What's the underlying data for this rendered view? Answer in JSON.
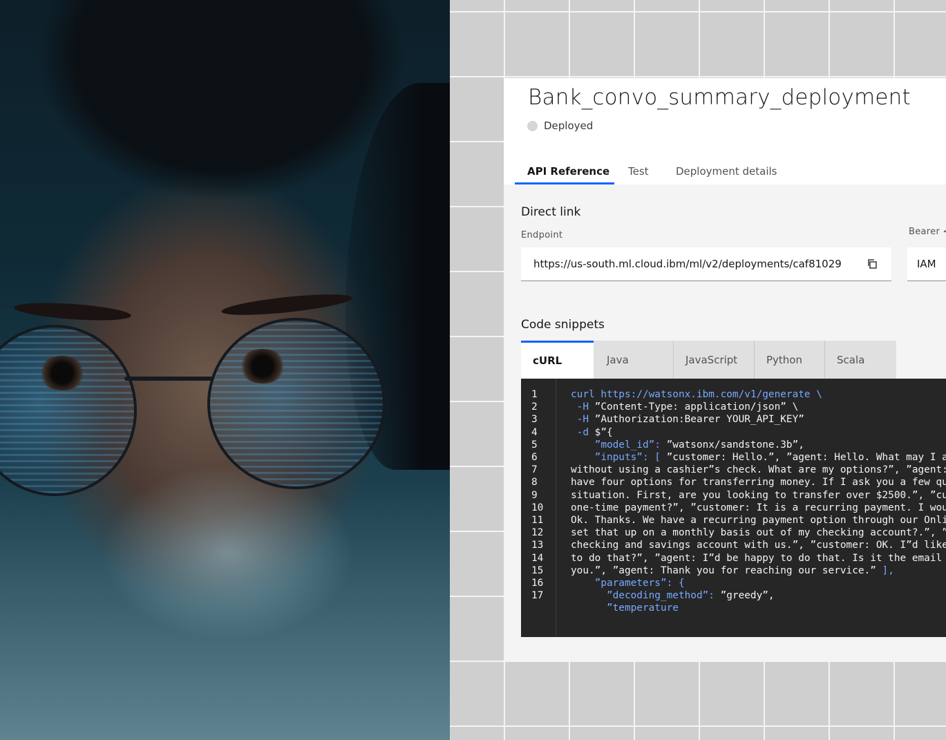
{
  "deployment": {
    "title": "Bank_convo_summary_deployment",
    "status": "Deployed"
  },
  "tabs": [
    {
      "label": "API Reference",
      "active": true
    },
    {
      "label": "Test",
      "active": false
    },
    {
      "label": "Deployment details",
      "active": false
    }
  ],
  "direct_link": {
    "heading": "Direct link",
    "endpoint_label": "Endpoint",
    "endpoint_value": "https://us-south.ml.cloud.ibm/ml/v2/deployments/caf81029",
    "bearer_label": "Bearer <",
    "bearer_value": "IAM"
  },
  "code_snippets": {
    "heading": "Code snippets",
    "languages": [
      {
        "label": "cURL",
        "active": true
      },
      {
        "label": "Java",
        "active": false
      },
      {
        "label": "JavaScript",
        "active": false
      },
      {
        "label": "Python",
        "active": false
      },
      {
        "label": "Scala",
        "active": false
      }
    ],
    "lines": [
      {
        "n": "1",
        "parts": [
          {
            "t": "curl https://watsonx.ibm.com/v1/generate \\",
            "c": "k"
          }
        ]
      },
      {
        "n": "2",
        "parts": [
          {
            "t": " -H ",
            "c": "k"
          },
          {
            "t": "”Content-Type: application/json” \\",
            "c": "s"
          }
        ]
      },
      {
        "n": "3",
        "parts": [
          {
            "t": " -H ",
            "c": "k"
          },
          {
            "t": "”Authorization:Bearer YOUR_API_KEY”",
            "c": "s"
          }
        ]
      },
      {
        "n": "4",
        "parts": [
          {
            "t": " -d ",
            "c": "k"
          },
          {
            "t": "$”{",
            "c": "s"
          }
        ]
      },
      {
        "n": "5",
        "parts": [
          {
            "t": "    ”model_id”: ",
            "c": "k"
          },
          {
            "t": "”watsonx/sandstone.3b”,",
            "c": "s"
          }
        ]
      },
      {
        "n": "6",
        "parts": [
          {
            "t": "    ”inputs”: [ ",
            "c": "k"
          },
          {
            "t": "”customer: Hello.”, ”agent: Hello. What may I as",
            "c": "s"
          }
        ]
      },
      {
        "n": "7",
        "parts": [
          {
            "t": "without using a cashier”s check. What are my options?”, ”agent: ",
            "c": "s"
          }
        ]
      },
      {
        "n": "8",
        "parts": [
          {
            "t": "have four options for transferring money. If I ask you a few que",
            "c": "s"
          }
        ]
      },
      {
        "n": "9",
        "parts": [
          {
            "t": "situation. First, are you looking to transfer over $2500.”, ”cus",
            "c": "s"
          }
        ]
      },
      {
        "n": "10",
        "parts": [
          {
            "t": "one-time payment?”, ”customer: It is a recurring payment. I woul",
            "c": "s"
          }
        ]
      },
      {
        "n": "11",
        "parts": [
          {
            "t": "Ok. Thanks. We have a recurring payment option through our Onlin",
            "c": "s"
          }
        ]
      },
      {
        "n": "12",
        "parts": [
          {
            "t": "set that up on a monthly basis out of my checking account?.”, ”a",
            "c": "s"
          }
        ]
      },
      {
        "n": "13",
        "parts": [
          {
            "t": "checking and savings account with us.”, ”customer: OK. I”d like ",
            "c": "s"
          }
        ]
      },
      {
        "n": "14",
        "parts": [
          {
            "t": "to do that?”, ”agent: I”d be happy to do that. Is it the email y",
            "c": "s"
          }
        ]
      },
      {
        "n": "15",
        "parts": [
          {
            "t": "you.”, ”agent: Thank you for reaching our service.” ",
            "c": "s"
          },
          {
            "t": "],",
            "c": "k"
          }
        ]
      },
      {
        "n": "16",
        "parts": [
          {
            "t": "    ”parameters”: {",
            "c": "k"
          }
        ]
      },
      {
        "n": "17",
        "parts": [
          {
            "t": "      ”decoding_method”: ",
            "c": "k"
          },
          {
            "t": "”greedy”,",
            "c": "s"
          }
        ]
      },
      {
        "n": "",
        "parts": [
          {
            "t": "      ”temperature",
            "c": "k"
          }
        ]
      }
    ]
  },
  "colors": {
    "accent": "#0f62fe",
    "code_bg": "#262626",
    "keyword": "#78a9ff"
  }
}
